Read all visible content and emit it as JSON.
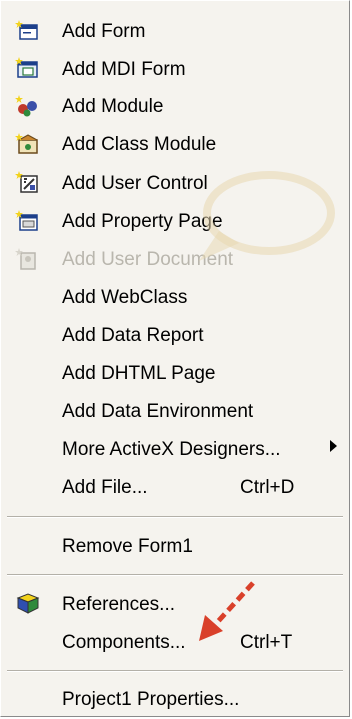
{
  "menu": {
    "items": [
      {
        "label": "Add Form",
        "icon": "add-form-icon"
      },
      {
        "label": "Add MDI Form",
        "icon": "add-mdi-form-icon"
      },
      {
        "label": "Add Module",
        "icon": "add-module-icon"
      },
      {
        "label": "Add Class Module",
        "icon": "add-class-module-icon"
      },
      {
        "label": "Add User Control",
        "icon": "add-user-control-icon"
      },
      {
        "label": "Add Property Page",
        "icon": "add-property-page-icon"
      },
      {
        "label": "Add User Document",
        "icon": "add-user-document-icon",
        "disabled": true
      },
      {
        "label": "Add WebClass"
      },
      {
        "label": "Add Data Report"
      },
      {
        "label": "Add DHTML Page"
      },
      {
        "label": "Add Data Environment"
      },
      {
        "label": "More ActiveX Designers...",
        "submenu": true
      },
      {
        "label": "Add File...",
        "shortcut": "Ctrl+D"
      },
      {
        "label": "Remove Form1"
      },
      {
        "label": "References...",
        "icon": "references-icon"
      },
      {
        "label": "Components...",
        "shortcut": "Ctrl+T"
      },
      {
        "label": "Project1 Properties..."
      }
    ]
  },
  "colors": {
    "menu_bg": "#f5f3ee",
    "disabled_text": "#b9b6ad",
    "annotation_arrow": "#d9402a",
    "watermark": "#e8d7b0"
  }
}
